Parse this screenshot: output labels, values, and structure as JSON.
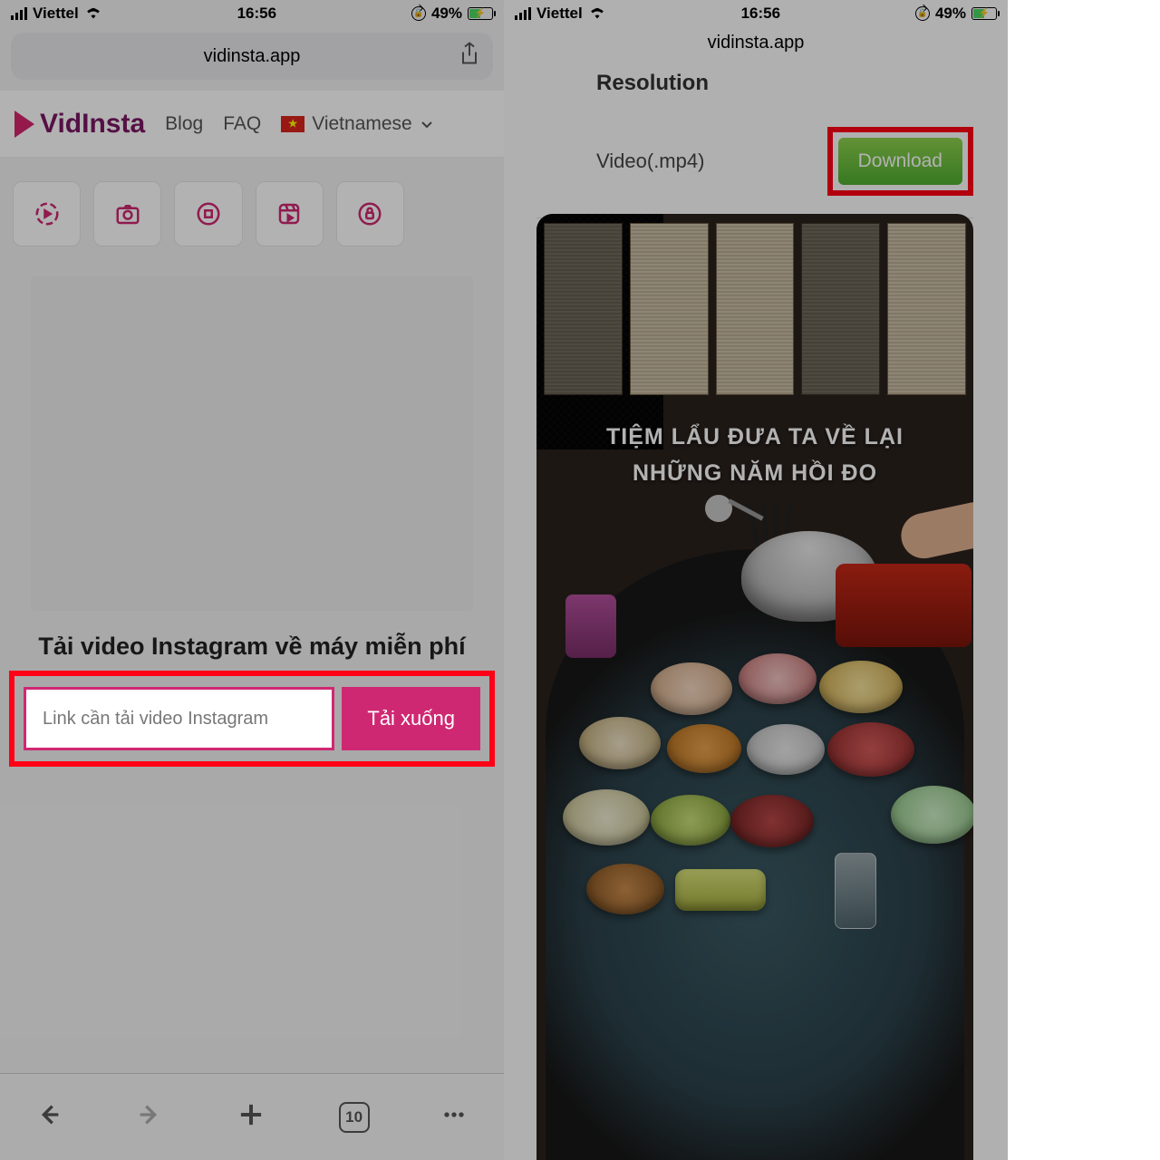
{
  "status": {
    "carrier": "Viettel",
    "time": "16:56",
    "battery": "49%"
  },
  "left": {
    "url": "vidinsta.app",
    "brand": "VidInsta",
    "nav": {
      "blog": "Blog",
      "faq": "FAQ",
      "lang": "Vietnamese"
    },
    "heading": "Tải video Instagram về máy miễn phí",
    "input_placeholder": "Link cần tải video Instagram",
    "download_btn": "Tải xuống",
    "tabs_count": "10"
  },
  "right": {
    "url": "vidinsta.app",
    "resolution_label": "Resolution",
    "file_label": "Video(.mp4)",
    "download_btn": "Download",
    "caption_line1": "TIỆM LẨU ĐƯA TA VỀ LẠI",
    "caption_line2": "NHỮNG NĂM HỒI ĐO"
  }
}
